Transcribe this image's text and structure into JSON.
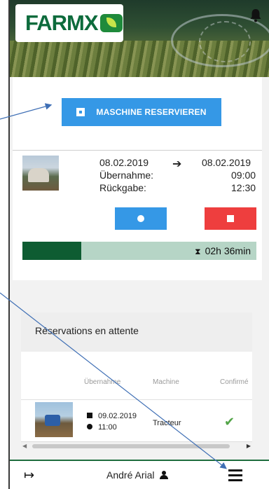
{
  "header": {
    "logo_text": "FARMX",
    "bell_icon": "bell-icon"
  },
  "actions": {
    "reserve_label": "MASCHINE RESERVIEREN"
  },
  "active_reservation": {
    "date_start": "08.02.2019",
    "date_end": "08.02.2019",
    "pickup_label": "Übernahme:",
    "pickup_time": "09:00",
    "return_label": "Rückgabe:",
    "return_time": "12:30",
    "remaining": "02h 36min",
    "progress_fraction": 0.25
  },
  "pending": {
    "title": "Réservations en attente",
    "columns": [
      "Übernahme",
      "Machine",
      "Confirmé"
    ],
    "rows": [
      {
        "date": "09.02.2019",
        "time": "11:00",
        "machine": "Tracteur"
      }
    ]
  },
  "bottom_nav": {
    "user_name": "André Arial"
  },
  "colors": {
    "primary_blue": "#3598e6",
    "danger_red": "#ee3e3e",
    "brand_green": "#0e5c32",
    "progress_bg": "#b6d5c6",
    "check_green": "#52a447"
  }
}
